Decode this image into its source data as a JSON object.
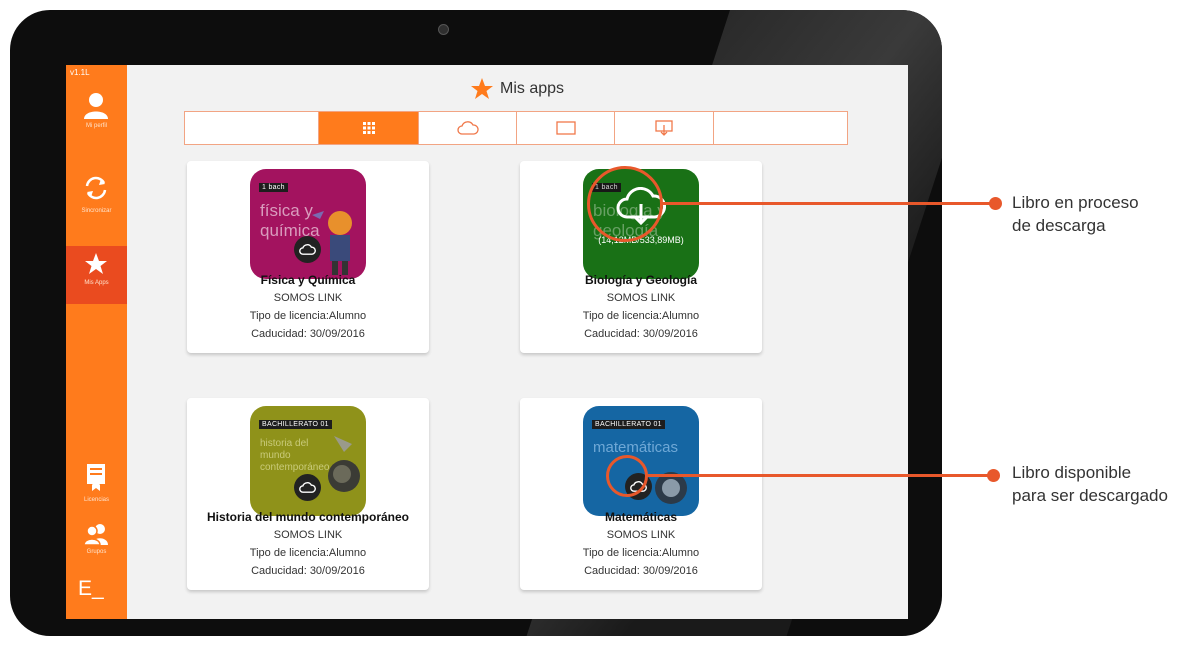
{
  "sidebar": {
    "version": "v1.1L",
    "items": [
      {
        "label": "Mi perfil",
        "icon": "profile-icon"
      },
      {
        "label": "Sincronizar",
        "icon": "sync-icon"
      },
      {
        "label": "Mis Apps",
        "icon": "star-icon",
        "active": true
      },
      {
        "label": "Licencias",
        "icon": "license-icon"
      },
      {
        "label": "Grupos",
        "icon": "groups-icon"
      }
    ],
    "brand": "E_"
  },
  "header": {
    "title": "Mis apps",
    "icon": "star-icon"
  },
  "tabs": [
    {
      "icon": "none"
    },
    {
      "icon": "grid-icon",
      "active": true
    },
    {
      "icon": "cloud-icon"
    },
    {
      "icon": "tablet-icon"
    },
    {
      "icon": "download-icon"
    },
    {
      "icon": "none"
    }
  ],
  "books": [
    {
      "title": "Física y Química",
      "publisher": "SOMOS LINK",
      "license": "Tipo de licencia:Alumno",
      "expiry": "Caducidad: 30/09/2016",
      "cover_color": "#a3135f",
      "cover_tag": "1 bach",
      "cover_text": "física y química",
      "status_icon": "cloud-icon"
    },
    {
      "title": "Biología y Geología",
      "publisher": "SOMOS LINK",
      "license": "Tipo de licencia:Alumno",
      "expiry": "Caducidad: 30/09/2016",
      "cover_color": "#1f8a1c",
      "cover_tag": "1 bach",
      "cover_text": "biología y geología",
      "status_icon": "cloud-download-icon",
      "download_progress": "(14,12MB/533,89MB)"
    },
    {
      "title": "Historia del mundo contemporáneo",
      "publisher": "SOMOS LINK",
      "license": "Tipo de licencia:Alumno",
      "expiry": "Caducidad: 30/09/2016",
      "cover_color": "#8f921a",
      "cover_tag": "BACHILLERATO 01",
      "cover_text": "historia del mundo contemporáneo",
      "status_icon": "cloud-icon"
    },
    {
      "title": "Matemáticas",
      "publisher": "SOMOS LINK",
      "license": "Tipo de licencia:Alumno",
      "expiry": "Caducidad: 30/09/2016",
      "cover_color": "#1566a3",
      "cover_tag": "BACHILLERATO 01",
      "cover_text": "matemáticas",
      "status_icon": "cloud-icon"
    }
  ],
  "annotations": [
    {
      "line1": "Libro en proceso",
      "line2": "de descarga"
    },
    {
      "line1": "Libro disponible",
      "line2": "para ser descargado"
    }
  ],
  "colors": {
    "accent": "#ff7b1c",
    "active": "#ea4b1f",
    "annotation": "#e8582b"
  }
}
